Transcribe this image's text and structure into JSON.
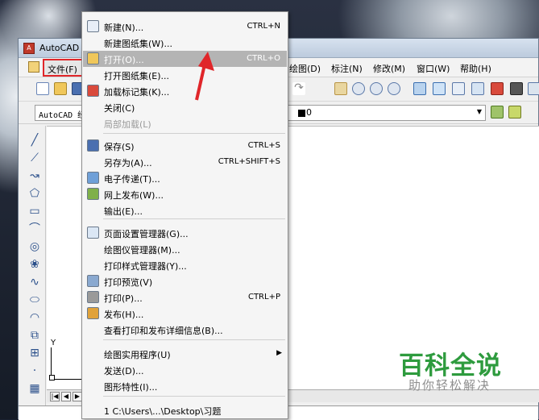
{
  "window": {
    "title": "AutoCAD 2"
  },
  "menubar": {
    "file": "文件(F)",
    "items": [
      "绘图(D)",
      "标注(N)",
      "修改(M)",
      "窗口(W)",
      "帮助(H)"
    ]
  },
  "toolbar": {
    "text_style": "AutoCAD 经",
    "layer_value": "0"
  },
  "axis": {
    "y": "Y"
  },
  "file_menu": {
    "items": [
      {
        "label": "新建(N)...",
        "shortcut": "CTRL+N",
        "icon": "new-file-icon"
      },
      {
        "label": "新建图纸集(W)...",
        "shortcut": ""
      },
      {
        "label": "打开(O)...",
        "shortcut": "CTRL+O",
        "icon": "open-folder-icon",
        "highlighted": true
      },
      {
        "label": "打开图纸集(E)...",
        "shortcut": ""
      },
      {
        "label": "加载标记集(K)...",
        "shortcut": "",
        "icon": "markup-icon"
      },
      {
        "label": "关闭(C)",
        "shortcut": ""
      },
      {
        "label": "局部加载(L)",
        "shortcut": "",
        "disabled": true
      },
      {
        "label": "保存(S)",
        "shortcut": "CTRL+S",
        "icon": "save-icon"
      },
      {
        "label": "另存为(A)...",
        "shortcut": "CTRL+SHIFT+S"
      },
      {
        "label": "电子传递(T)...",
        "shortcut": "",
        "icon": "etransmit-icon"
      },
      {
        "label": "网上发布(W)...",
        "shortcut": "",
        "icon": "web-publish-icon"
      },
      {
        "label": "输出(E)...",
        "shortcut": ""
      },
      {
        "label": "页面设置管理器(G)...",
        "shortcut": "",
        "icon": "page-setup-icon"
      },
      {
        "label": "绘图仪管理器(M)...",
        "shortcut": ""
      },
      {
        "label": "打印样式管理器(Y)...",
        "shortcut": ""
      },
      {
        "label": "打印预览(V)",
        "shortcut": "",
        "icon": "print-preview-icon"
      },
      {
        "label": "打印(P)...",
        "shortcut": "CTRL+P",
        "icon": "print-icon"
      },
      {
        "label": "发布(H)...",
        "shortcut": "",
        "icon": "publish-icon"
      },
      {
        "label": "查看打印和发布详细信息(B)...",
        "shortcut": ""
      },
      {
        "label": "绘图实用程序(U)",
        "shortcut": "",
        "submenu": true
      },
      {
        "label": "发送(D)...",
        "shortcut": ""
      },
      {
        "label": "图形特性(I)...",
        "shortcut": ""
      },
      {
        "label": "1 C:\\Users\\...\\Desktop\\习题",
        "shortcut": ""
      }
    ]
  },
  "watermark": {
    "main": "百科全说",
    "sub": "助你轻松解决"
  },
  "colors": {
    "highlight": "#b4b4b4",
    "annotation_red": "#e0262a",
    "watermark_green": "#2e9b3e"
  }
}
